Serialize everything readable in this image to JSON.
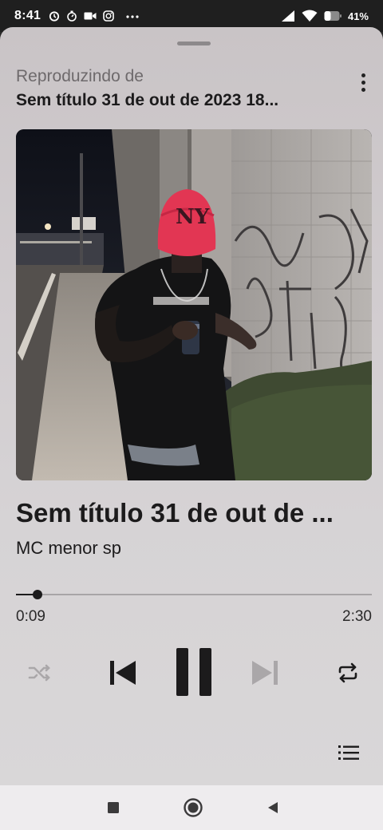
{
  "status_bar": {
    "time": "8:41",
    "battery": "41%",
    "left_icons": [
      "alarm-icon",
      "timer-icon",
      "video-icon",
      "instagram-icon",
      "more-notifications-icon"
    ],
    "right_icons": [
      "signal-icon",
      "wifi-icon",
      "battery-icon"
    ]
  },
  "player": {
    "playing_from_label": "Reproduzindo de",
    "playing_from_title": "Sem título 31 de out de 2023 18...",
    "track_title": "Sem título 31 de out de ...",
    "artist": "MC menor sp",
    "elapsed": "0:09",
    "duration": "2:30",
    "progress": 0.06,
    "controls": [
      "shuffle-icon",
      "previous-icon",
      "pause-icon",
      "next-icon",
      "repeat-icon",
      "queue-icon"
    ],
    "colors": {
      "primary_text": "#1c1b1c",
      "secondary_text": "#6e6a6c",
      "disabled": "#aaa7a9"
    }
  },
  "nav_bar": {
    "buttons": [
      "recents-icon",
      "home-icon",
      "back-icon"
    ]
  }
}
